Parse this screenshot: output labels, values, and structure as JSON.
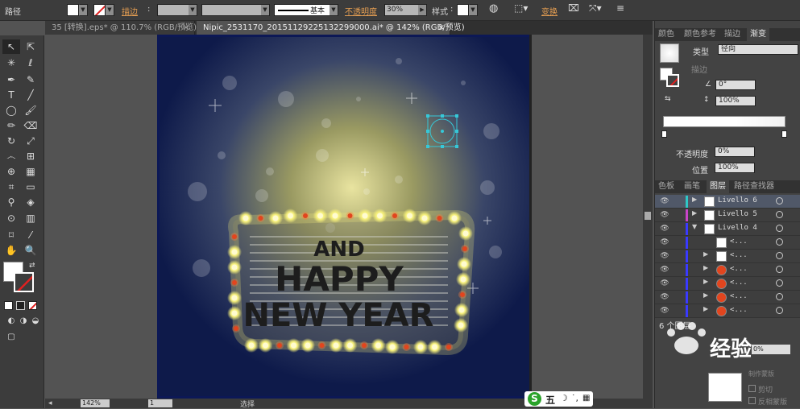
{
  "control_bar": {
    "path_label": "路径",
    "stroke_label": "描边",
    "stroke_value": "",
    "profile_label": "基本",
    "opacity_label": "不透明度",
    "opacity_value": "30%",
    "style_label": "样式",
    "transform_label": "变换"
  },
  "document_tabs": [
    {
      "label": "35 [转换].eps* @ 110.7% (RGB/预览)",
      "close": "×"
    },
    {
      "label": "Nipic_2531170_20151129225132299000.ai* @ 142% (RGB/预览)",
      "close": "×"
    }
  ],
  "artwork": {
    "line1": "AND",
    "line2": "HAPPY",
    "line3": "NEW YEAR"
  },
  "status_bar": {
    "zoom": "142%",
    "page": "1",
    "tool": "选择"
  },
  "panels": {
    "top_tabs": [
      "颜色",
      "颜色参考",
      "描边",
      "渐变"
    ],
    "gradient": {
      "type_label": "类型",
      "type_value": "径向",
      "stroke_label": "描边",
      "angle_value": "0°",
      "ratio_value": "100%",
      "opacity_label": "不透明度",
      "opacity_value": "0%",
      "location_label": "位置",
      "location_value": "100%"
    },
    "layer_tabs": [
      "色板",
      "画笔",
      "图层",
      "路径查找器"
    ],
    "layers": [
      {
        "name": "Livello 6",
        "color": "#2fc7c7",
        "expanded": false
      },
      {
        "name": "Livello 5",
        "color": "#c844c8",
        "expanded": false
      },
      {
        "name": "Livello 4",
        "color": "#3a3aff",
        "expanded": true
      }
    ],
    "sublayers": [
      "<...",
      "<...",
      "<...",
      "<...",
      "<...",
      "<..."
    ],
    "layer_count": "6 个图层",
    "opacity_bottom_value": "0%",
    "clip_label": "剪切",
    "invert_mask_label": "反相蒙版",
    "make_mask_label": "制作蒙版"
  },
  "watermark": {
    "text": "经验",
    "ime_label": "五"
  }
}
